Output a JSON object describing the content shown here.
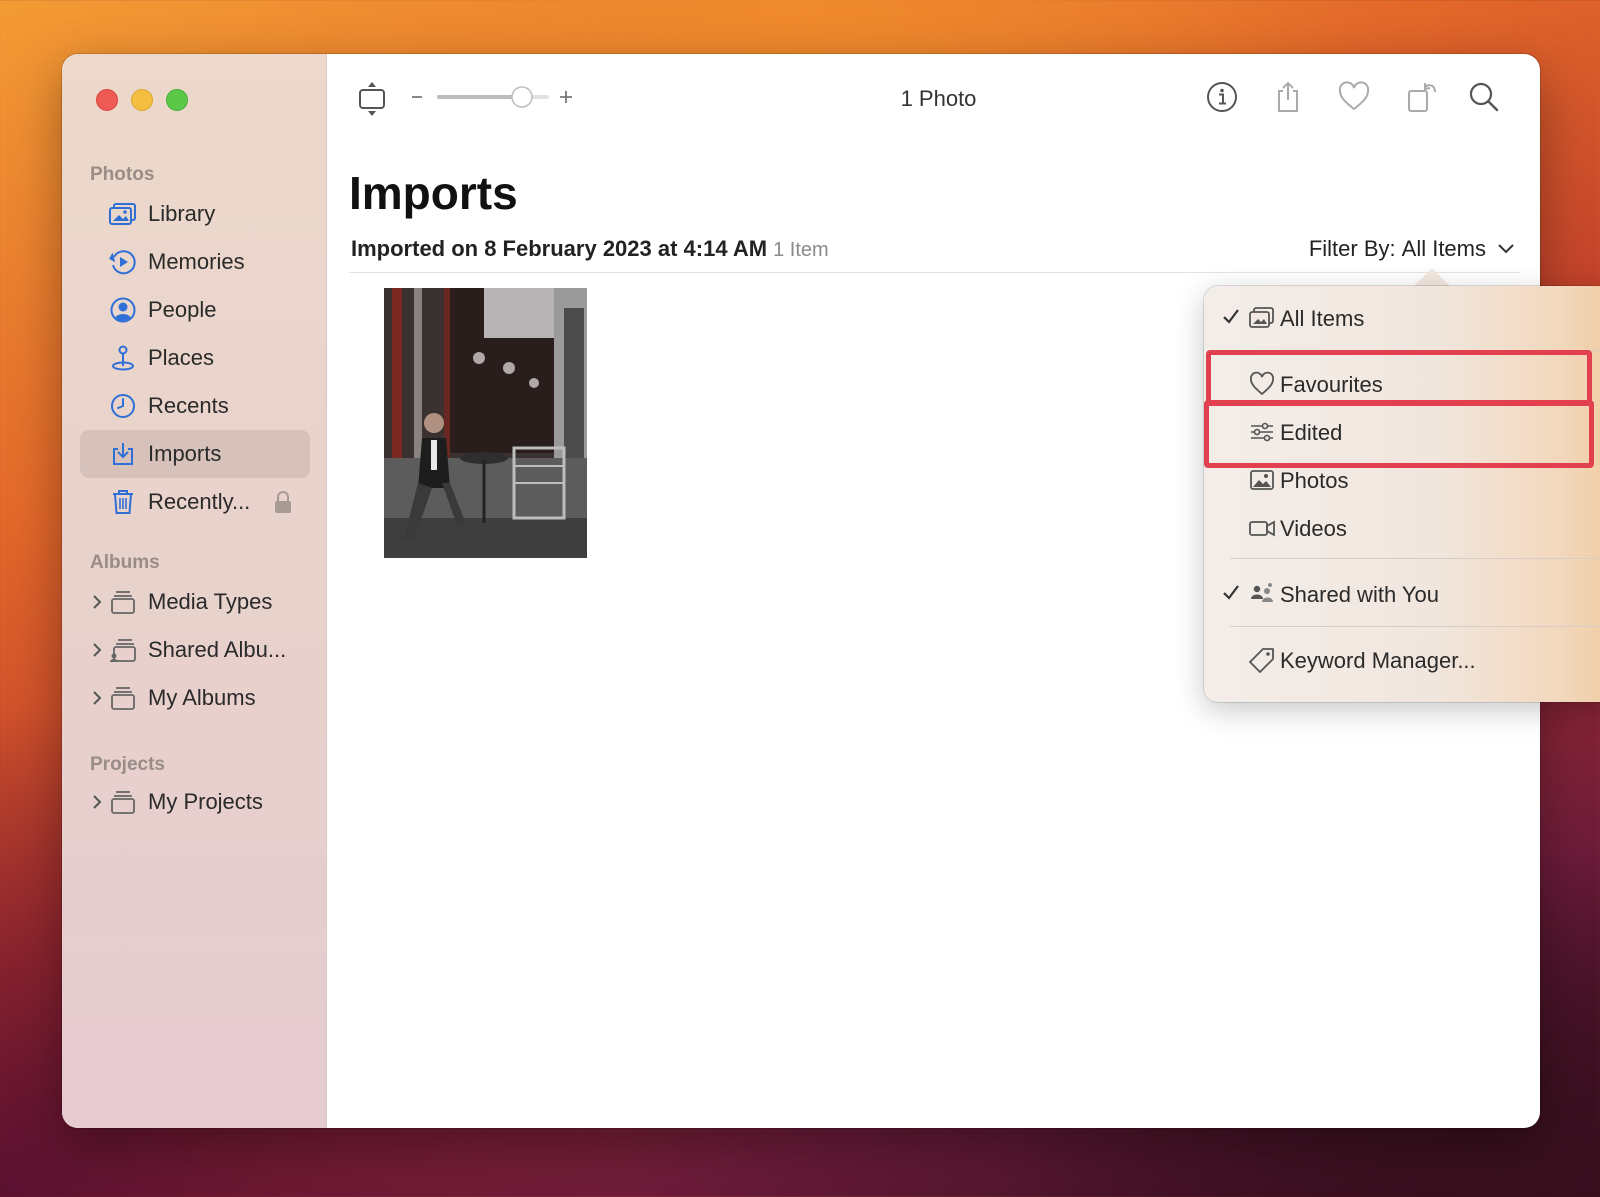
{
  "window": {
    "toolbar": {
      "title": "1 Photo"
    },
    "sidebar": {
      "sections": {
        "photos": "Photos",
        "albums": "Albums",
        "projects": "Projects"
      },
      "items": [
        {
          "label": "Library",
          "icon": "library-icon"
        },
        {
          "label": "Memories",
          "icon": "memories-icon"
        },
        {
          "label": "People",
          "icon": "people-icon"
        },
        {
          "label": "Places",
          "icon": "places-icon"
        },
        {
          "label": "Recents",
          "icon": "recents-icon"
        },
        {
          "label": "Imports",
          "icon": "imports-icon",
          "selected": true
        },
        {
          "label": "Recently...",
          "icon": "trash-icon",
          "locked": true
        }
      ],
      "albums": [
        {
          "label": "Media Types"
        },
        {
          "label": "Shared Albu..."
        },
        {
          "label": "My Albums"
        }
      ],
      "projects": [
        {
          "label": "My Projects"
        }
      ]
    },
    "main": {
      "title": "Imports",
      "subtitle": "Imported on 8 February 2023 at 4:14 AM",
      "count": "1 Item",
      "filter_prefix": "Filter By:",
      "filter_value": "All Items"
    },
    "filter_menu": {
      "items": [
        {
          "label": "All Items",
          "checked": true
        },
        {
          "label": "Favourites",
          "highlighted": true
        },
        {
          "label": "Edited",
          "highlighted": true
        },
        {
          "label": "Photos"
        },
        {
          "label": "Videos"
        },
        {
          "label": "Shared with You",
          "checked": true
        },
        {
          "label": "Keyword Manager..."
        }
      ],
      "highlight_color": "#e2404f"
    }
  }
}
